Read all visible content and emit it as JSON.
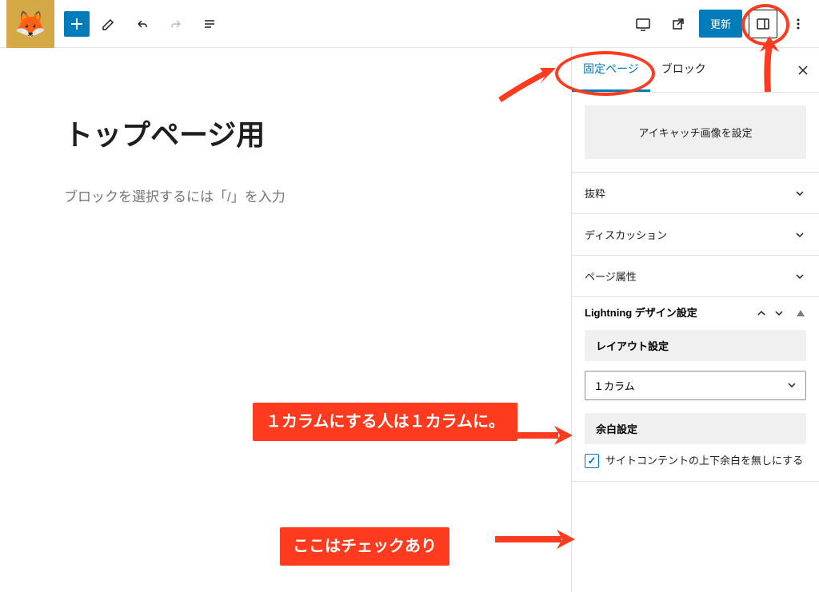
{
  "topbar": {
    "update_label": "更新"
  },
  "editor": {
    "page_title": "トップページ用",
    "block_prompt": "ブロックを選択するには「/」を入力"
  },
  "sidebar": {
    "tabs": {
      "page": "固定ページ",
      "block": "ブロック"
    },
    "featured_image": "アイキャッチ画像を設定",
    "panels": {
      "excerpt": "抜粋",
      "discussion": "ディスカッション",
      "page_attrs": "ページ属性",
      "lightning": "Lightning デザイン設定"
    },
    "layout": {
      "title": "レイアウト設定",
      "value": "１カラム"
    },
    "margin": {
      "title": "余白設定",
      "checkbox_label": "サイトコンテントの上下余白を無しにする"
    }
  },
  "annotations": {
    "column_note": "１カラムにする人は１カラムに。",
    "check_note": "ここはチェックあり"
  }
}
